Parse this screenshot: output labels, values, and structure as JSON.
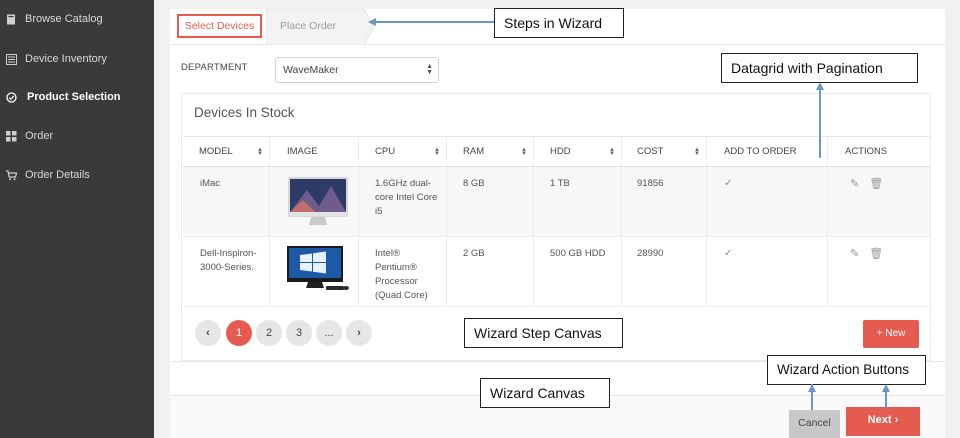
{
  "sidebar": {
    "items": [
      {
        "label": "Browse Catalog",
        "icon": "book-icon"
      },
      {
        "label": "Device Inventory",
        "icon": "list-icon"
      },
      {
        "label": "Product Selection",
        "icon": "check-circle-icon",
        "active": true
      },
      {
        "label": "Order",
        "icon": "grid-icon"
      },
      {
        "label": "Order Details",
        "icon": "cart-icon"
      }
    ]
  },
  "wizard": {
    "steps": [
      {
        "label": "Select Devices",
        "active": true
      },
      {
        "label": "Place Order",
        "active": false
      }
    ],
    "department": {
      "label": "DEPARTMENT",
      "value": "WaveMaker"
    },
    "panel_title": "Devices In Stock",
    "grid": {
      "columns": [
        "MODEL",
        "IMAGE",
        "CPU",
        "RAM",
        "HDD",
        "COST",
        "ADD TO ORDER",
        "ACTIONS"
      ],
      "rows": [
        {
          "model": "iMac",
          "cpu": "1.6GHz dual-core Intel Core i5",
          "ram": "8 GB",
          "hdd": "1 TB",
          "cost": "91856",
          "add_to_order": "✓"
        },
        {
          "model": "Dell-Inspiron-3000-Series.",
          "cpu": "Intel® Pentium® Processor (Quad Core)",
          "ram": "2 GB",
          "hdd": "500 GB HDD",
          "cost": "28990",
          "add_to_order": "✓"
        }
      ]
    },
    "pagination": {
      "prev": "‹",
      "pages": [
        "1",
        "2",
        "3",
        "..."
      ],
      "next": "›",
      "current": "1"
    },
    "new_button": "+ New",
    "cancel_button": "Cancel",
    "next_button": "Next ›"
  },
  "annotations": {
    "steps": "Steps in Wizard",
    "datagrid": "Datagrid with Pagination",
    "step_canvas": "Wizard  Step Canvas",
    "action_buttons": "Wizard Action Buttons",
    "canvas": "Wizard Canvas"
  },
  "colors": {
    "accent": "#e55b4f",
    "sidebar_bg": "#3a3a3a",
    "annotation_arrow": "#6b96c8"
  }
}
